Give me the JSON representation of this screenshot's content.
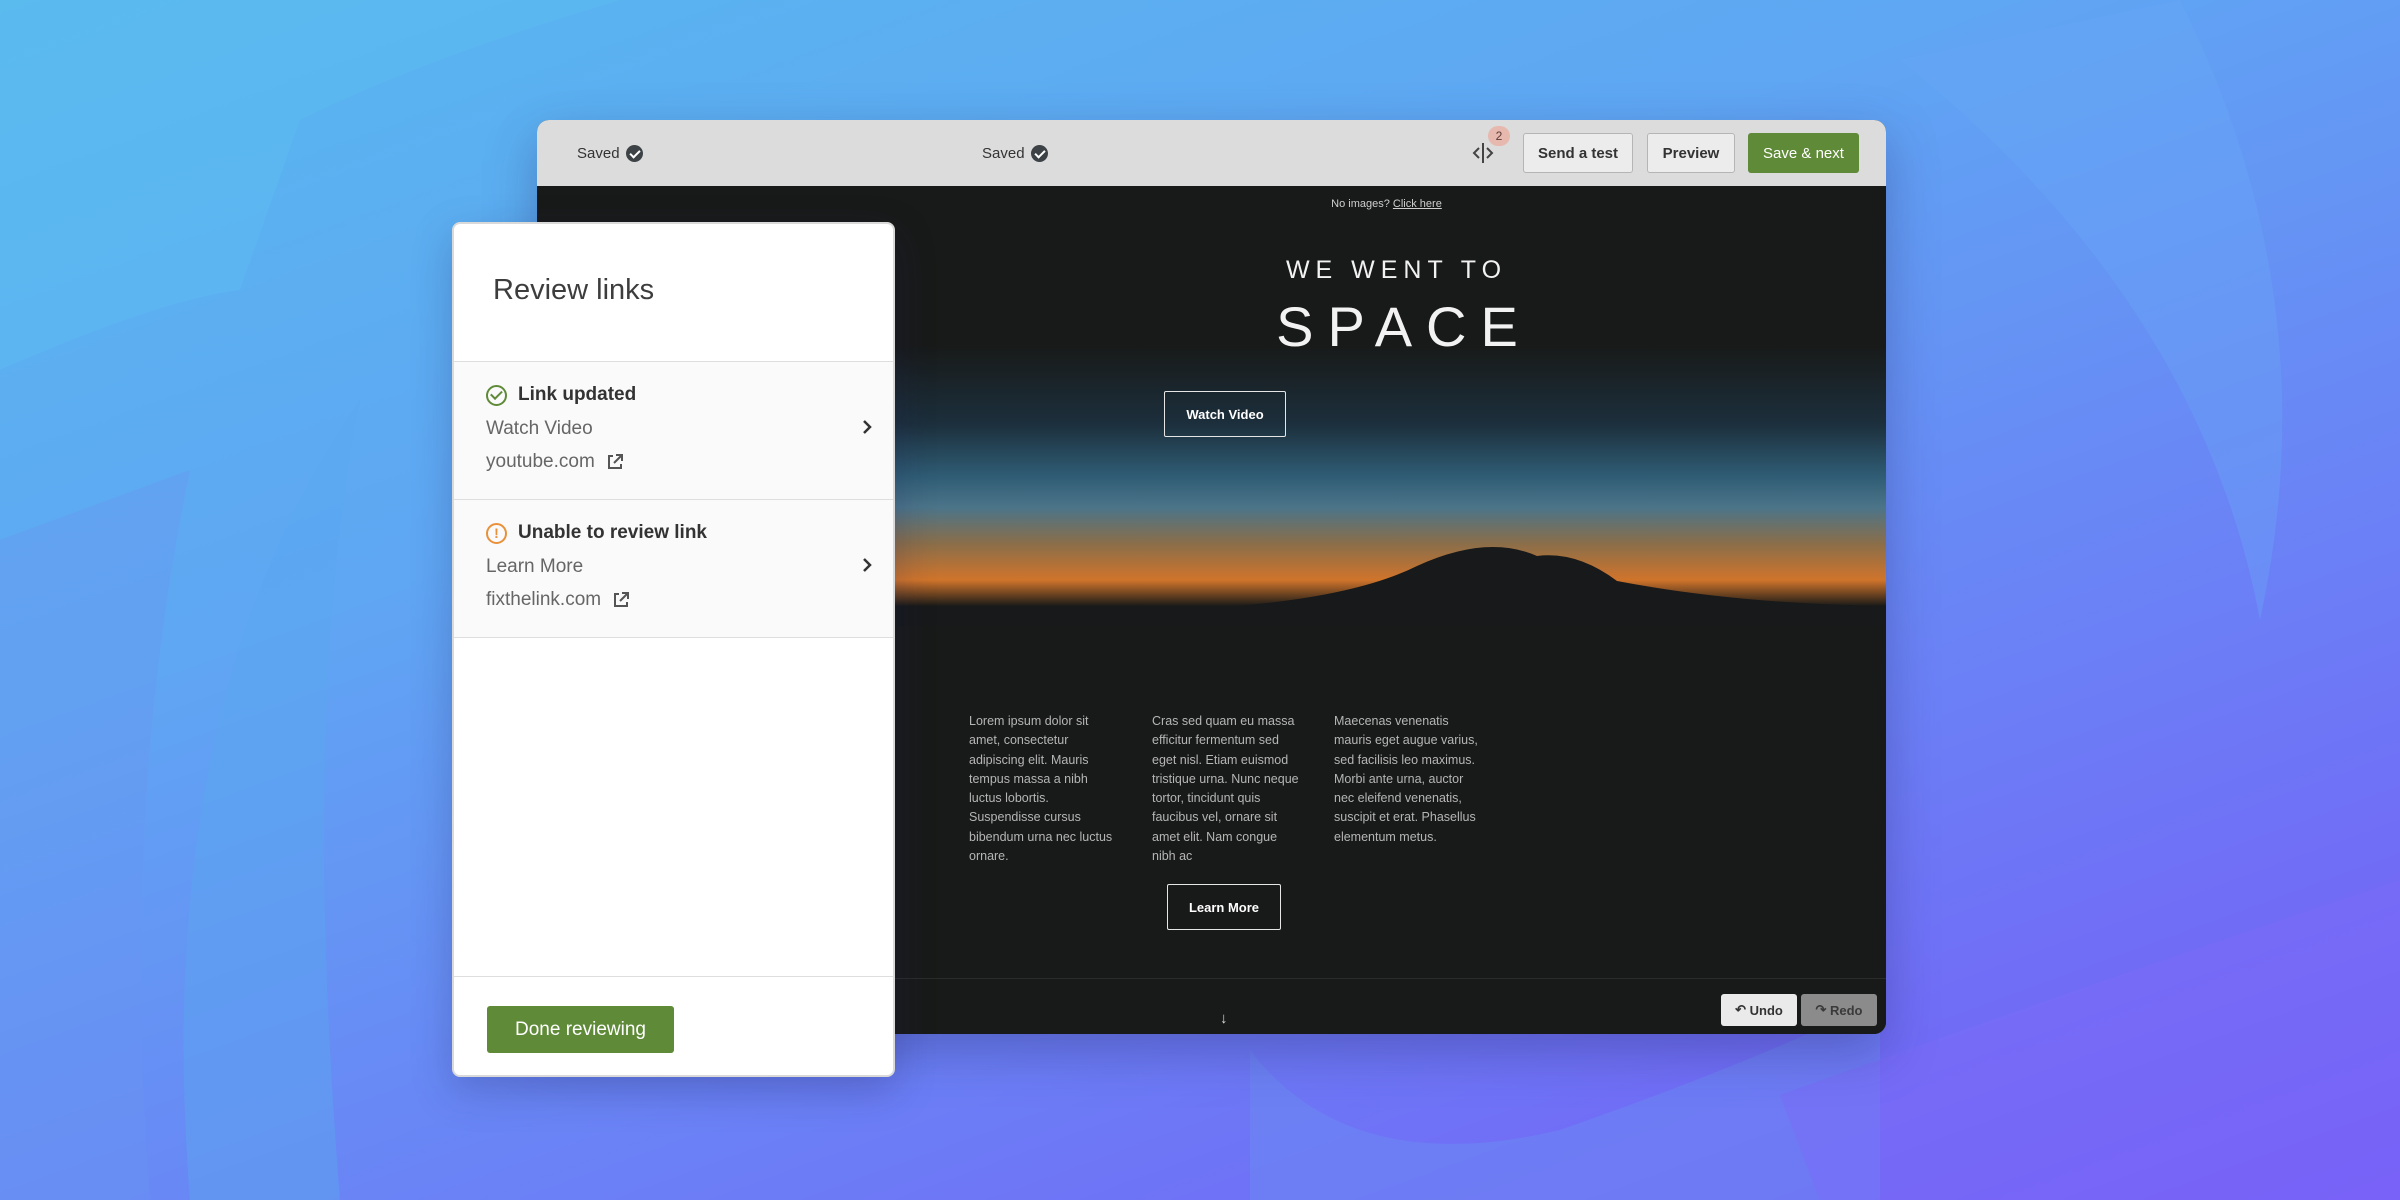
{
  "toolbar": {
    "saved_left": "Saved",
    "saved_center": "Saved",
    "changes_count": "2",
    "send_test_label": "Send a test",
    "preview_label": "Preview",
    "save_next_label": "Save & next"
  },
  "email": {
    "no_images_text": "No images?",
    "no_images_link": "Click here",
    "hero_subtitle": "WE WENT TO",
    "hero_title": "SPACE",
    "watch_video_label": "Watch Video",
    "columns": [
      "Lorem ipsum dolor sit amet, consectetur adipiscing elit. Mauris tempus massa a nibh luctus lobortis. Suspendisse cursus bibendum urna nec luctus ornare.",
      "Cras sed quam eu massa efficitur fermentum sed eget nisl. Etiam euismod tristique urna. Nunc neque tortor, tincidunt quis faucibus vel, ornare sit amet elit. Nam congue nibh ac",
      "Maecenas venenatis mauris eget augue varius, sed facilisis leo maximus. Morbi ante urna, auctor nec eleifend venenatis, suscipit et erat. Phasellus elementum metus."
    ],
    "learn_more_label": "Learn More",
    "scroll_arrow": "↓"
  },
  "history": {
    "undo_label": "Undo",
    "redo_label": "Redo"
  },
  "review_panel": {
    "title": "Review links",
    "links": [
      {
        "status": "Link updated",
        "status_type": "success",
        "label": "Watch Video",
        "url": "youtube.com"
      },
      {
        "status": "Unable to review link",
        "status_type": "warning",
        "label": "Learn More",
        "url": "fixthelink.com"
      }
    ],
    "done_label": "Done reviewing"
  },
  "colors": {
    "accent_green": "#5f8a38",
    "warning_orange": "#e8913a",
    "canvas_dark": "#181a19"
  }
}
